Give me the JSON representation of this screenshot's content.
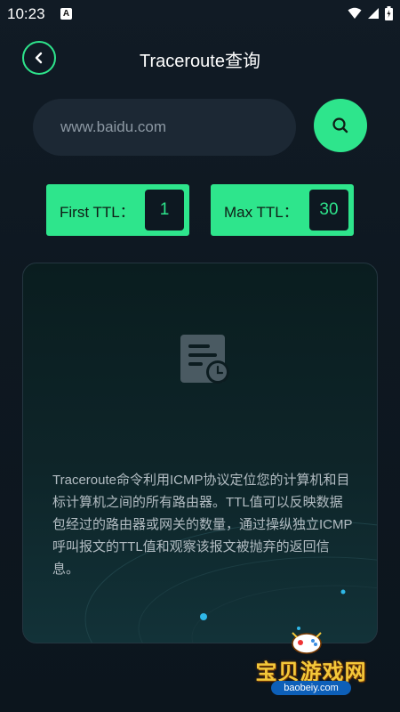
{
  "status_bar": {
    "time": "10:23",
    "a_badge": "A",
    "icons": [
      "wifi-icon",
      "signal-icon",
      "battery-icon"
    ]
  },
  "header": {
    "title": "Traceroute查询",
    "back_icon": "chevron-left-icon"
  },
  "search": {
    "value": "www.baidu.com",
    "button_icon": "search-icon"
  },
  "ttl": {
    "first_label": "First TTL：",
    "first_value": "1",
    "max_label": "Max TTL：",
    "max_value": "30"
  },
  "result": {
    "icon": "document-clock-icon",
    "description": "Traceroute命令利用ICMP协议定位您的计算机和目标计算机之间的所有路由器。TTL值可以反映数据包经过的路由器或网关的数量，通过操纵独立ICMP呼叫报文的TTL值和观察该报文被抛弃的返回信息。"
  },
  "watermark": {
    "text": "宝贝游戏网",
    "url": "baobeiy.com"
  },
  "colors": {
    "accent": "#2ee58c",
    "background": "#0e1822",
    "input_bg": "#1c2834",
    "text_muted": "#b2bcc2"
  }
}
